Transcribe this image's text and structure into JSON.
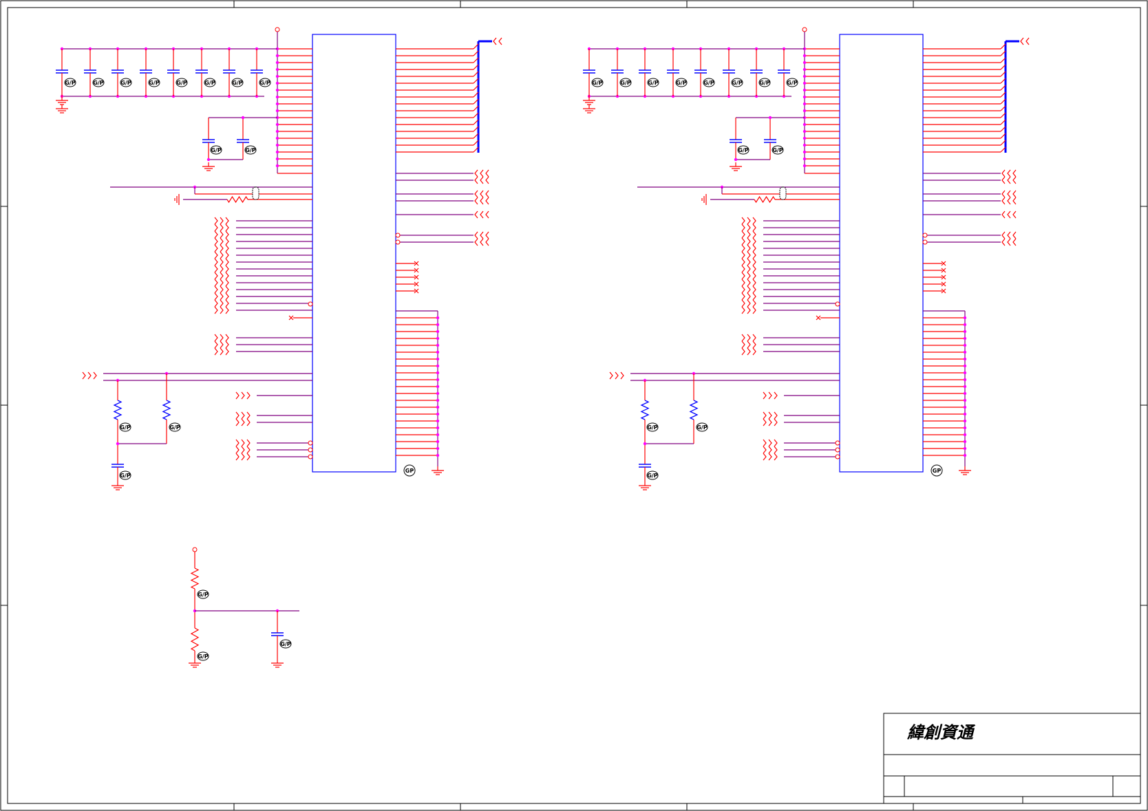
{
  "title_block": {
    "company": "緯創資通"
  },
  "parts": {
    "nopop_mark": "G/P",
    "gp_mark": "GP"
  },
  "colors": {
    "wire": "#ff0000",
    "net": "#800080",
    "body": "#0000ff",
    "junction": "#ff00ff",
    "frame": "#000000"
  },
  "icons": [
    "ground-icon",
    "capacitor-icon",
    "resistor-icon",
    "offpage-arrow-icon",
    "no-connect-icon"
  ]
}
